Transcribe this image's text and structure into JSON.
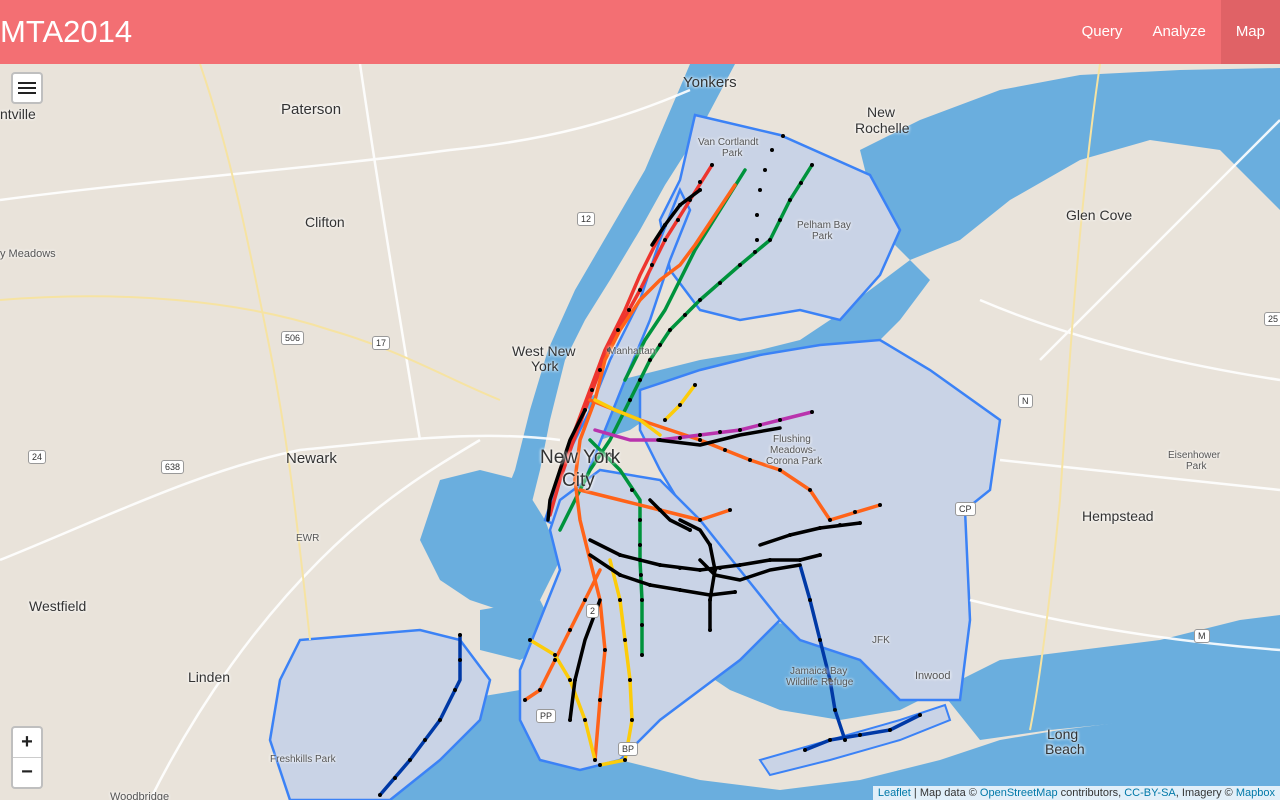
{
  "navbar": {
    "brand": "MTA2014",
    "items": [
      {
        "label": "Query",
        "active": false
      },
      {
        "label": "Analyze",
        "active": false
      },
      {
        "label": "Map",
        "active": true
      }
    ],
    "background": "#f36f73"
  },
  "map": {
    "place_labels": {
      "yonkers": "Yonkers",
      "paterson": "Paterson",
      "new_rochelle_1": "New",
      "new_rochelle_2": "Rochelle",
      "glen_cove": "Glen Cove",
      "clifton": "Clifton",
      "west_new_york_1": "West New",
      "west_new_york_2": "York",
      "newark": "Newark",
      "new_york_1": "New York",
      "new_york_2": "City",
      "hempstead": "Hempstead",
      "westfield": "Westfield",
      "linden": "Linden",
      "inwood": "Inwood",
      "long_beach_1": "Long",
      "long_beach_2": "Beach",
      "ntville": "ntville",
      "y_meadows": "y Meadows",
      "van_cortlandt_1": "Van Cortlandt",
      "van_cortlandt_2": "Park",
      "pelham_bay_1": "Pelham Bay",
      "pelham_bay_2": "Park",
      "manhattan": "Manhattan",
      "flushing_1": "Flushing",
      "flushing_2": "Meadows-",
      "flushing_3": "Corona Park",
      "eisenhower_1": "Eisenhower",
      "eisenhower_2": "Park",
      "jamaica_1": "Jamaica Bay",
      "jamaica_2": "Wildlife Refuge",
      "freshkills": "Freshkills Park",
      "woodbridge": "Woodbridge",
      "ewr": "EWR",
      "jfk": "JFK"
    },
    "shields": {
      "r12": "12",
      "r506": "506",
      "r17": "17",
      "r24": "24",
      "r638": "638",
      "r25": "25",
      "rN": "N",
      "rCP": "CP",
      "rM": "M",
      "r2": "2",
      "rBP": "BP",
      "rPP": "PP"
    },
    "colors": {
      "water": "#6aaede",
      "land": "#e9e3da",
      "nyc_fill": "#c9d3e6",
      "boundary": "#3b82f6",
      "line_red": "#ee352e",
      "line_green": "#00933c",
      "line_orange": "#ff6319",
      "line_yellow": "#fccc0a",
      "line_purple": "#b933ad",
      "line_blue": "#0039a6",
      "line_black": "#000000"
    }
  },
  "controls": {
    "layers_icon": "menu-icon",
    "zoom_in": "+",
    "zoom_out": "−"
  },
  "attribution": {
    "leaflet": "Leaflet",
    "sep1": " | Map data © ",
    "osm": "OpenStreetMap",
    "contrib": " contributors, ",
    "ccbysa": "CC-BY-SA",
    "imagery": ", Imagery © ",
    "mapbox": "Mapbox"
  }
}
